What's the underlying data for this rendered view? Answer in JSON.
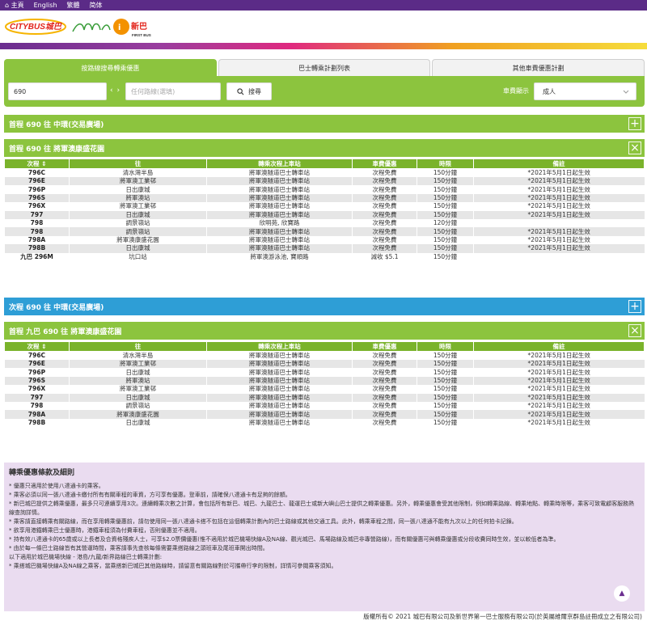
{
  "topbar": {
    "home": "主頁",
    "english": "English",
    "trad": "繁體",
    "simp": "简体"
  },
  "brand": {
    "citybus": "CITYBUS城巴",
    "firstbus_cn": "新巴",
    "firstbus_en": "FIRST BUS"
  },
  "tabs": [
    "按路線搜尋轉乘優惠",
    "巴士轉乘計劃列表",
    "其他車費優惠計劃"
  ],
  "search": {
    "route_value": "690",
    "to_placeholder": "任何路線(選填)",
    "arrows": "‹ ›",
    "search_label": "搜尋",
    "fare_label": "車費顯示",
    "fare_value": "成人"
  },
  "sections": {
    "s1": "首程 690 往 中環(交易廣場)",
    "s2": "首程 690 往 將軍澳康盛花園",
    "s3": "次程 690 往 中環(交易廣場)",
    "s4": "首程 九巴 690 往 將軍澳康盛花園"
  },
  "table_headers": [
    "次程 ⇕",
    "往",
    "轉乘次程上車站",
    "車費優惠",
    "時限",
    "備註"
  ],
  "table1": [
    [
      "796C",
      "清水灣半島",
      "將軍澳隧道巴士轉車站",
      "次程免費",
      "150分鐘",
      "*2021年5月1日起生效"
    ],
    [
      "796E",
      "將軍澳工業邨",
      "將軍澳隧道巴士轉車站",
      "次程免費",
      "150分鐘",
      "*2021年5月1日起生效"
    ],
    [
      "796P",
      "日出康城",
      "將軍澳隧道巴士轉車站",
      "次程免費",
      "150分鐘",
      "*2021年5月1日起生效"
    ],
    [
      "796S",
      "將軍澳站",
      "將軍澳隧道巴士轉車站",
      "次程免費",
      "150分鐘",
      "*2021年5月1日起生效"
    ],
    [
      "796X",
      "將軍澳工業邨",
      "將軍澳隧道巴士轉車站",
      "次程免費",
      "150分鐘",
      "*2021年5月1日起生效"
    ],
    [
      "797",
      "日出康城",
      "將軍澳隧道巴士轉車站",
      "次程免費",
      "150分鐘",
      "*2021年5月1日起生效"
    ],
    [
      "798",
      "調景嶺站",
      "欣明苑, 欣寶路",
      "次程免費",
      "120分鐘",
      ""
    ],
    [
      "798",
      "調景嶺站",
      "將軍澳隧道巴士轉車站",
      "次程免費",
      "150分鐘",
      "*2021年5月1日起生效"
    ],
    [
      "798A",
      "將軍澳康盛花園",
      "將軍澳隧道巴士轉車站",
      "次程免費",
      "150分鐘",
      "*2021年5月1日起生效"
    ],
    [
      "798B",
      "日出康城",
      "將軍澳隧道巴士轉車站",
      "次程免費",
      "150分鐘",
      "*2021年5月1日起生效"
    ],
    [
      "九巴 296M",
      "坑口站",
      "將軍澳游泳池, 寶順路",
      "減收 $5.1",
      "150分鐘",
      ""
    ]
  ],
  "table2": [
    [
      "796C",
      "清水灣半島",
      "將軍澳隧道巴士轉車站",
      "次程免費",
      "150分鐘",
      "*2021年5月1日起生效"
    ],
    [
      "796E",
      "將軍澳工業邨",
      "將軍澳隧道巴士轉車站",
      "次程免費",
      "150分鐘",
      "*2021年5月1日起生效"
    ],
    [
      "796P",
      "日出康城",
      "將軍澳隧道巴士轉車站",
      "次程免費",
      "150分鐘",
      "*2021年5月1日起生效"
    ],
    [
      "796S",
      "將軍澳站",
      "將軍澳隧道巴士轉車站",
      "次程免費",
      "150分鐘",
      "*2021年5月1日起生效"
    ],
    [
      "796X",
      "將軍澳工業邨",
      "將軍澳隧道巴士轉車站",
      "次程免費",
      "150分鐘",
      "*2021年5月1日起生效"
    ],
    [
      "797",
      "日出康城",
      "將軍澳隧道巴士轉車站",
      "次程免費",
      "150分鐘",
      "*2021年5月1日起生效"
    ],
    [
      "798",
      "調景嶺站",
      "將軍澳隧道巴士轉車站",
      "次程免費",
      "150分鐘",
      "*2021年5月1日起生效"
    ],
    [
      "798A",
      "將軍澳康盛花園",
      "將軍澳隧道巴士轉車站",
      "次程免費",
      "150分鐘",
      "*2021年5月1日起生效"
    ],
    [
      "798B",
      "日出康城",
      "將軍澳隧道巴士轉車站",
      "次程免費",
      "150分鐘",
      "*2021年5月1日起生效"
    ]
  ],
  "notes": {
    "title": "轉乘優惠條款及細則",
    "items": [
      "* 優惠只適用於使用八達通卡的乘客。",
      "* 乘客必須以同一張八達通卡繳付所有有關車程的車資，方可享有優惠。登車前，請確保八達通卡有足夠的餘額。",
      "* 新巴城巴提供之轉乘優惠，最多只可連續享用3次。連續轉乘次數之計算，會包括所有新巴、城巴、九龍巴士、龍運巴士或新大嶼山巴士提供之轉乘優惠。另外，轉乘優惠會受其他限制，例如轉乘路線、轉乘地點、轉乘時限等，乘客可致電顧客服務熱線查詢詳情。",
      "* 乘客請直接轉乘有關路線，而在享用轉乘優惠前，請勿使用同一張八達通卡搭不包括在這個轉乘計劃內的巴士路線或其他交通工具。此外，轉乘車程之間，同一張八達通不能有九次以上的任何拍卡記錄。",
      "* 欲享用港鐵轉乘巴士優惠時，港鐵車程須為付費車程，否則優惠並不適用。",
      "* 持有效八達通卡的65歲或以上長者及合資格殘疾人士，可享$2.0票價優惠(惟不適用於城巴機場快線A及NA線、觀光城巴、馬場路線及城巴非專營路線)，而有關優惠可與轉乘優惠或分段收費同時生效，並以較低者為準。",
      "* 由於每一條巴士路線皆有其營運時間，乘客請事先查核每條需要乘搭路線之頭班車及尾班車開出時間。",
      "以下適用於城巴機場快線 - 港島/九龍/新界路線巴士轉乘計劃:",
      "* 乘搭城巴機場快線A及NA線之乘客，當乘搭新巴城巴其他路線時，請留意有關路線對於可攜帶行李的限制，詳情可參閱乘客須知。"
    ]
  },
  "footer": "版權所有© 2021 城巴有限公司及新世界第一巴士服務有限公司(於英屬維爾京群島註冊成立之有限公司)"
}
